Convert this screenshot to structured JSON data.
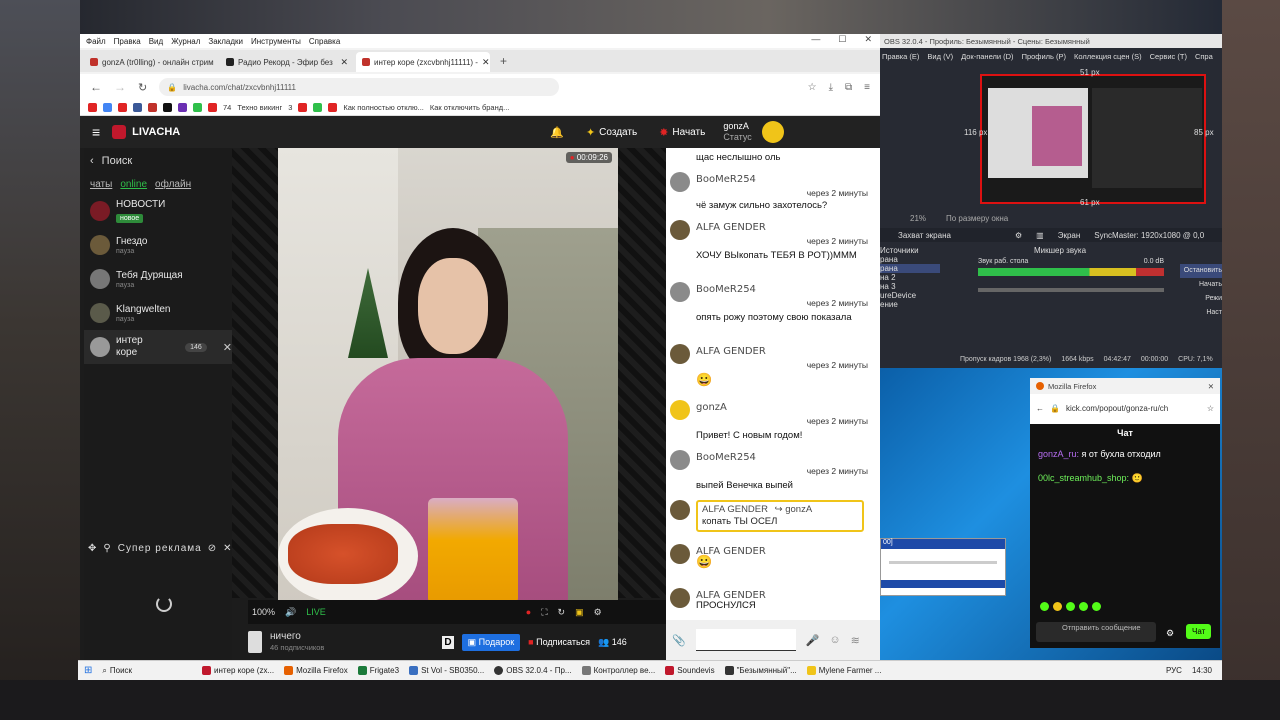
{
  "browser": {
    "menu": [
      "Файл",
      "Правка",
      "Вид",
      "Журнал",
      "Закладки",
      "Инструменты",
      "Справка"
    ],
    "tabs": [
      {
        "label": "gonzA (tr0lling) - онлайн стрим"
      },
      {
        "label": "Радио Рекорд - Эфир без"
      },
      {
        "label": "интер коре (zxcvbnhj11111) - "
      }
    ],
    "url": "livacha.com/chat/zxcvbnhj11111",
    "bookmarks": [
      "74",
      "Техно викинг",
      "3",
      "Как полностью отклю...",
      "Как отключить бранд..."
    ]
  },
  "app": {
    "brand": "LIVACHA",
    "create_label": "Создать",
    "start_label": "Начать",
    "user": "gonzA",
    "status": "Статус",
    "search": "Поиск",
    "filters": [
      "чаты",
      "online",
      "офлайн"
    ],
    "channels": [
      {
        "name": "НОВОСТИ",
        "sub": "новое",
        "new": true
      },
      {
        "name": "Гнездо",
        "sub": "пауза"
      },
      {
        "name": "Тебя Дурящая",
        "sub": "пауза"
      },
      {
        "name": "Klangwelten",
        "sub": "пауза"
      },
      {
        "name": "интер коре",
        "count": "146"
      }
    ],
    "super_ad": "Супер реклама",
    "rec_time": "00:09:26",
    "volume": "100%",
    "live": "LIVE",
    "streamer_name": "ничего",
    "subscribers": "46 подписчиков",
    "gift": "Подарок",
    "subscribe": "Подписаться",
    "viewers": "146"
  },
  "chat": {
    "first_text": "щас неслышно оль",
    "messages": [
      {
        "name": "BooMeR254",
        "time": "через 2 минуты",
        "text": "чё замуж сильно захотелось?"
      },
      {
        "name": "ALFA GENDER",
        "time": "через 2 минуты",
        "text": "ХОЧУ ВЫкопать ТЕБЯ В РОТ))МММ"
      },
      {
        "name": "BooMeR254",
        "time": "через 2 минуты",
        "text": "опять рожу поэтому свою показала"
      },
      {
        "name": "ALFA GENDER",
        "time": "через 2 минуты",
        "text": "😀"
      },
      {
        "name": "gonzA",
        "time": "через 2 минуты",
        "text": "Привет!  С новым годом!"
      },
      {
        "name": "BooMeR254",
        "time": "через 2 минуты",
        "text": "выпей Венечка выпей"
      }
    ],
    "reply": {
      "name": "ALFA GENDER",
      "to": "↪ gonzA",
      "text": "копать ТЫ ОСЕЛ"
    },
    "after": [
      {
        "name": "ALFA GENDER",
        "text": "😀"
      },
      {
        "name": "ALFA GENDER",
        "text": "ПРОСНУЛСЯ"
      }
    ]
  },
  "obs": {
    "title": "OBS 32.0.4 - Профиль: Безымянный - Сцены: Безымянный",
    "menu": [
      "Правка (E)",
      "Вид (V)",
      "Док-панели (D)",
      "Профиль (P)",
      "Коллекция сцен (S)",
      "Сервис (T)",
      "Спра"
    ],
    "sizes": [
      "51 px",
      "116 px",
      "85 px",
      "61 px"
    ],
    "zoom": "21%",
    "fit": "По размеру окна",
    "capture": "Захват экрана",
    "screen": "Экран",
    "monitor": "SyncMaster: 1920x1080 @ 0,0",
    "sources_title": "Источники",
    "mixer_title": "Микшер звука",
    "sources": [
      "рана",
      "рана",
      "на 2",
      "на 3",
      "ureDevice",
      "ение"
    ],
    "mixer_label": "Звук раб. стола",
    "mixer_db": "0.0 dB",
    "stats": [
      "Пропуск кадров 1968 (2,3%)",
      "1664 kbps",
      "04:42:47",
      "00:00:00",
      "CPU: 7,1%"
    ],
    "right_col": [
      "Остановить",
      "Начать",
      "Режи",
      "Наст"
    ]
  },
  "kick": {
    "window_title": "Mozilla Firefox",
    "url": "kick.com/popout/gonza-ru/ch",
    "header": "Чат",
    "messages": [
      {
        "name": "gonzA_ru:",
        "text": "я от бухла отходил"
      },
      {
        "name": "00lc_streamhub_shop:",
        "text": "🙂"
      }
    ],
    "placeholder": "Отправить сообщение",
    "send": "Чат"
  },
  "mini_window": {
    "label": "00]"
  },
  "taskbar": {
    "search": "Поиск",
    "items": [
      "интер коре (zx...",
      "Mozilla Firefox",
      "Frigate3",
      "St Vol - SB0350...",
      "OBS 32.0.4 - Пр...",
      "Контроллер ве...",
      "Soundevis",
      "\"Безымянный\"...",
      "Mylene Farmer ..."
    ],
    "lang": "РУС",
    "time": "14:30"
  },
  "colors": {
    "accent_yellow": "#f0c419",
    "live_green": "#2fbf4a",
    "gift_blue": "#1e6fe0",
    "rec_red": "#e02424",
    "subscribe_red": "#c0182c"
  }
}
